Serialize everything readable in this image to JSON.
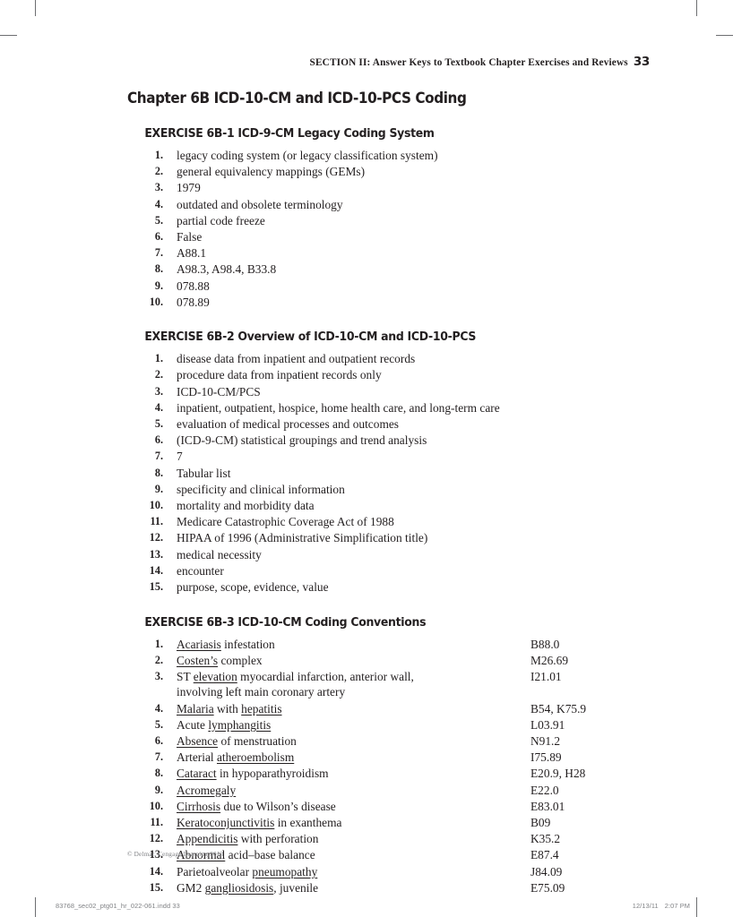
{
  "running_head": {
    "text": "SECTION II:  Answer Keys to Textbook Chapter Exercises and Reviews",
    "page_number": "33"
  },
  "chapter": {
    "title": "Chapter 6B  ICD-10-CM and ICD-10-PCS Coding"
  },
  "exercises": [
    {
      "title": "EXERCISE 6B-1  ICD-9-CM Legacy Coding System",
      "items": [
        {
          "number": "1.",
          "text": "legacy coding system (or legacy classification system)"
        },
        {
          "number": "2.",
          "text": "general equivalency mappings (GEMs)"
        },
        {
          "number": "3.",
          "text": "1979"
        },
        {
          "number": "4.",
          "text": "outdated and obsolete terminology"
        },
        {
          "number": "5.",
          "text": "partial code freeze"
        },
        {
          "number": "6.",
          "text": "False"
        },
        {
          "number": "7.",
          "text": "A88.1"
        },
        {
          "number": "8.",
          "text": "A98.3, A98.4, B33.8"
        },
        {
          "number": "9.",
          "text": "078.88"
        },
        {
          "number": "10.",
          "text": "078.89"
        }
      ]
    },
    {
      "title": "EXERCISE 6B-2  Overview of ICD-10-CM and ICD-10-PCS",
      "items": [
        {
          "number": "1.",
          "text": "disease data from inpatient and outpatient records"
        },
        {
          "number": "2.",
          "text": "procedure data from inpatient records only"
        },
        {
          "number": "3.",
          "text": "ICD-10-CM/PCS"
        },
        {
          "number": "4.",
          "text": "inpatient, outpatient, hospice, home health care, and long-term care"
        },
        {
          "number": "5.",
          "text": "evaluation of medical processes and outcomes"
        },
        {
          "number": "6.",
          "text": "(ICD-9-CM) statistical groupings and trend analysis"
        },
        {
          "number": "7.",
          "text": "7"
        },
        {
          "number": "8.",
          "text": "Tabular list"
        },
        {
          "number": "9.",
          "text": "specificity and clinical information"
        },
        {
          "number": "10.",
          "text": "mortality and morbidity data"
        },
        {
          "number": "11.",
          "text": "Medicare Catastrophic Coverage Act of 1988"
        },
        {
          "number": "12.",
          "text": "HIPAA of 1996 (Administrative Simplification title)"
        },
        {
          "number": "13.",
          "text": "medical necessity"
        },
        {
          "number": "14.",
          "text": "encounter"
        },
        {
          "number": "15.",
          "text": "purpose, scope, evidence, value"
        }
      ]
    },
    {
      "title": "EXERCISE 6B-3  ICD-10-CM Coding Conventions",
      "coded": true,
      "items": [
        {
          "number": "1.",
          "html": "<u>Acariasis</u> infestation",
          "code": "B88.0"
        },
        {
          "number": "2.",
          "html": "<u>Costen&rsquo;s</u> complex",
          "code": "M26.69"
        },
        {
          "number": "3.",
          "html": "ST <u>elevation</u> myocardial infarction, anterior wall,<br>involving left main coronary artery",
          "code": "I21.01"
        },
        {
          "number": "4.",
          "html": "<u>Malaria</u> with <u>hepatitis</u>",
          "code": "B54, K75.9"
        },
        {
          "number": "5.",
          "html": "Acute <u>lymphangitis</u>",
          "code": "L03.91"
        },
        {
          "number": "6.",
          "html": "<u>Absence</u> of menstruation",
          "code": "N91.2"
        },
        {
          "number": "7.",
          "html": "Arterial <u>atheroembolism</u>",
          "code": "I75.89"
        },
        {
          "number": "8.",
          "html": "<u>Cataract</u> in hypoparathyroidism",
          "code": "E20.9, H28"
        },
        {
          "number": "9.",
          "html": "<u>Acromegaly</u>",
          "code": "E22.0"
        },
        {
          "number": "10.",
          "html": "<u>Cirrhosis</u> due to Wilson&rsquo;s disease",
          "code": "E83.01"
        },
        {
          "number": "11.",
          "html": "<u>Keratoconjunctivitis</u> in exanthema",
          "code": "B09"
        },
        {
          "number": "12.",
          "html": "<u>Appendicitis</u> with perforation",
          "code": "K35.2"
        },
        {
          "number": "13.",
          "html": "<u>Abnormal</u> acid&ndash;base balance",
          "code": "E87.4"
        },
        {
          "number": "14.",
          "html": "Parietoalveolar <u>pneumopathy</u>",
          "code": "J84.09"
        },
        {
          "number": "15.",
          "html": "GM2 <u>gangliosidosis</u>, juvenile",
          "code": "E75.09"
        }
      ]
    }
  ],
  "footer": {
    "copyright": "© Delmar, Cengage Learning 2013",
    "file_name": "83768_sec02_ptg01_hr_022-061.indd   33",
    "date": "12/13/11",
    "time": "2:07 PM"
  }
}
